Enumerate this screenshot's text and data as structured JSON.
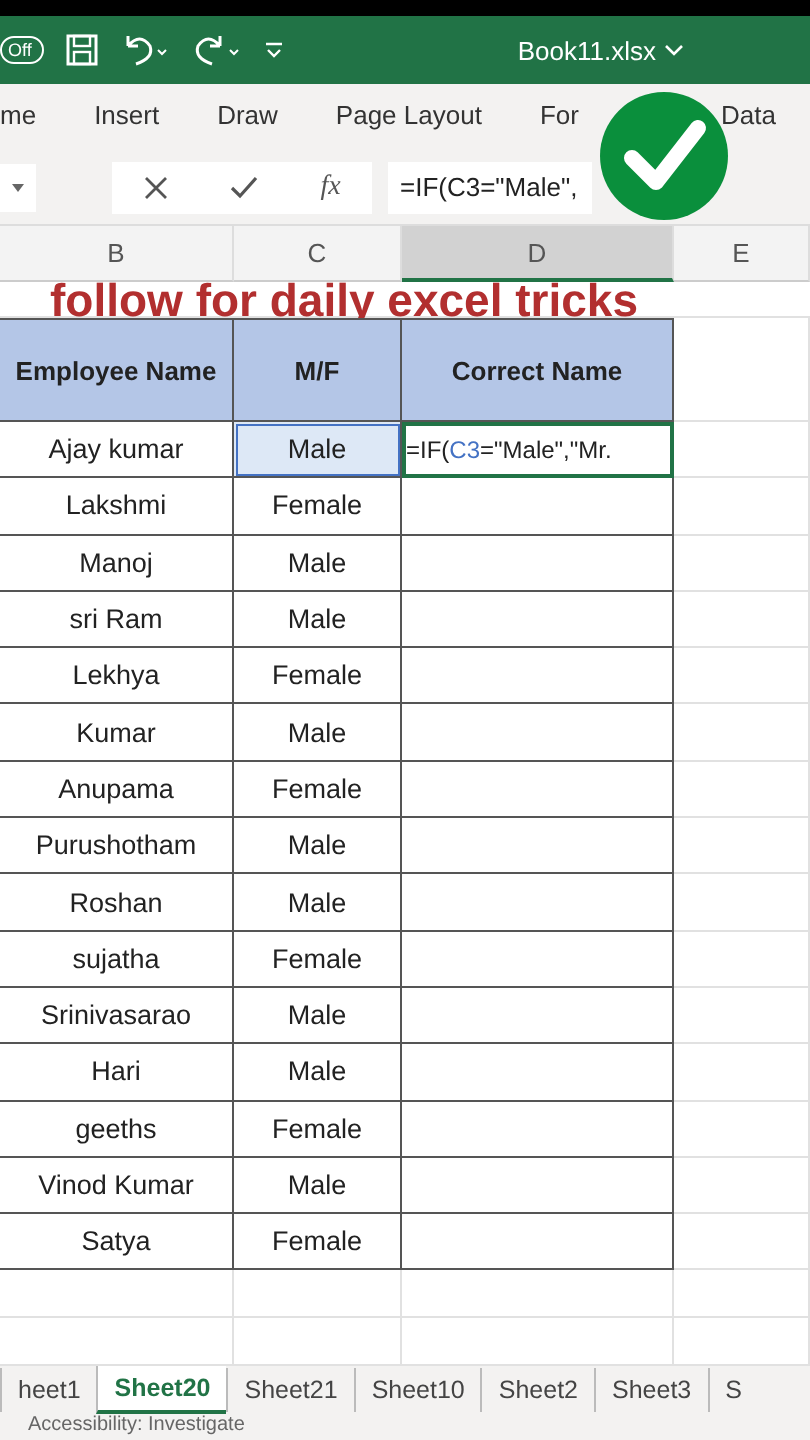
{
  "title_bar": {
    "autosave": "Off",
    "file_name": "Book11.xlsx"
  },
  "ribbon_tabs": [
    {
      "label": "me",
      "selected": false
    },
    {
      "label": "Insert",
      "selected": false
    },
    {
      "label": "Draw",
      "selected": false
    },
    {
      "label": "Page Layout",
      "selected": false
    },
    {
      "label": "For",
      "selected": false
    },
    {
      "label": "Data",
      "selected": false
    }
  ],
  "formula_bar": {
    "fx": "fx",
    "formula": "=IF(C3=\"Male\","
  },
  "overlay_caption": "follow for daily excel tricks",
  "column_headers": [
    {
      "label": "B",
      "selected": false
    },
    {
      "label": "C",
      "selected": false
    },
    {
      "label": "D",
      "selected": true
    },
    {
      "label": "E",
      "selected": false
    }
  ],
  "table": {
    "columns": [
      "Employee Name",
      "M/F",
      "Correct Name"
    ],
    "rows": [
      {
        "name": "Ajay kumar",
        "gender": "Male",
        "selected": true,
        "editing": {
          "before": "=IF(",
          "ref": "C3",
          "after": "=\"Male\",\"Mr."
        }
      },
      {
        "name": "Lakshmi",
        "gender": "Female",
        "selected": false
      },
      {
        "name": "Manoj",
        "gender": "Male",
        "selected": false
      },
      {
        "name": "sri Ram",
        "gender": "Male",
        "selected": false
      },
      {
        "name": "Lekhya",
        "gender": "Female",
        "selected": false
      },
      {
        "name": "Kumar",
        "gender": "Male",
        "selected": false
      },
      {
        "name": "Anupama",
        "gender": "Female",
        "selected": false
      },
      {
        "name": "Purushotham",
        "gender": "Male",
        "selected": false
      },
      {
        "name": "Roshan",
        "gender": "Male",
        "selected": false
      },
      {
        "name": "sujatha",
        "gender": "Female",
        "selected": false
      },
      {
        "name": "Srinivasarao",
        "gender": "Male",
        "selected": false
      },
      {
        "name": "Hari",
        "gender": "Male",
        "selected": false
      },
      {
        "name": "geeths",
        "gender": "Female",
        "selected": false
      },
      {
        "name": "Vinod Kumar",
        "gender": "Male",
        "selected": false
      },
      {
        "name": "Satya",
        "gender": "Female",
        "selected": false
      }
    ]
  },
  "sheet_tabs": [
    {
      "label": "heet1",
      "selected": false
    },
    {
      "label": "Sheet20",
      "selected": true
    },
    {
      "label": "Sheet21",
      "selected": false
    },
    {
      "label": "Sheet10",
      "selected": false
    },
    {
      "label": "Sheet2",
      "selected": false
    },
    {
      "label": "Sheet3",
      "selected": false
    },
    {
      "label": "S",
      "selected": false
    }
  ],
  "status_bar": "Accessibility: Investigate"
}
